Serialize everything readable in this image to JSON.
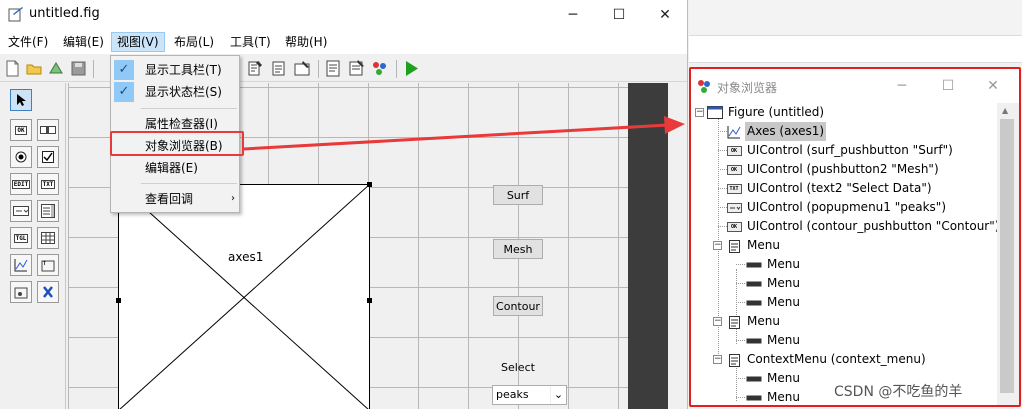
{
  "guide_window": {
    "title": "untitled.fig",
    "controls": {
      "minimize": "─",
      "maximize": "☐",
      "close": "✕"
    },
    "menus": [
      {
        "label": "文件(F)"
      },
      {
        "label": "编辑(E)"
      },
      {
        "label": "视图(V)"
      },
      {
        "label": "布局(L)"
      },
      {
        "label": "工具(T)"
      },
      {
        "label": "帮助(H)"
      }
    ],
    "active_menu": "视图(V)",
    "view_menu": {
      "items": [
        {
          "label": "显示工具栏(T)",
          "checked": true
        },
        {
          "label": "显示状态栏(S)",
          "checked": true
        },
        {
          "label": "属性检查器(I)",
          "checked": false
        },
        {
          "label": "对象浏览器(B)",
          "checked": false,
          "highlighted": true
        },
        {
          "label": "编辑器(E)",
          "checked": false
        },
        {
          "label": "查看回调",
          "checked": false,
          "submenu": true
        }
      ],
      "check_icon": "✓",
      "submenu_icon": "›"
    },
    "palette": {
      "tools": [
        {
          "name": "select-tool",
          "label": ""
        },
        {
          "name": "pushbutton-tool",
          "label": "OK"
        },
        {
          "name": "slider-tool",
          "label": ""
        },
        {
          "name": "radiobutton-tool",
          "label": ""
        },
        {
          "name": "checkbox-tool",
          "label": ""
        },
        {
          "name": "edit-text-tool",
          "label": "EDIT"
        },
        {
          "name": "static-text-tool",
          "label": "TXT"
        },
        {
          "name": "popup-menu-tool",
          "label": ""
        },
        {
          "name": "listbox-tool",
          "label": ""
        },
        {
          "name": "toggle-button-tool",
          "label": "TGL"
        },
        {
          "name": "table-tool",
          "label": ""
        },
        {
          "name": "axes-tool",
          "label": ""
        },
        {
          "name": "panel-tool",
          "label": ""
        },
        {
          "name": "button-group-tool",
          "label": ""
        },
        {
          "name": "activex-tool",
          "label": ""
        }
      ]
    },
    "canvas": {
      "axes_label": "axes1",
      "buttons": [
        {
          "name": "surf-button",
          "label": "Surf"
        },
        {
          "name": "mesh-button",
          "label": "Mesh"
        },
        {
          "name": "contour-button",
          "label": "Contour"
        }
      ],
      "select_label": "Select",
      "popup_value": "peaks",
      "popup_arrow": "⌄"
    }
  },
  "object_browser": {
    "title": "对象浏览器",
    "controls": {
      "minimize": "─",
      "maximize": "☐",
      "close": "✕"
    },
    "tree": [
      {
        "label": "Figure (untitled)",
        "level": 0,
        "icon": "figure-icon",
        "expander": "⊟"
      },
      {
        "label": "Axes (axes1)",
        "level": 1,
        "icon": "axes-icon",
        "selected": true
      },
      {
        "label": "UIControl (surf_pushbutton \"Surf\")",
        "level": 1,
        "icon": "pushbutton-icon",
        "chip": "OK"
      },
      {
        "label": "UIControl (pushbutton2 \"Mesh\")",
        "level": 1,
        "icon": "pushbutton-icon",
        "chip": "OK"
      },
      {
        "label": "UIControl (text2 \"Select Data\")",
        "level": 1,
        "icon": "text-icon",
        "chip": "TXT"
      },
      {
        "label": "UIControl (popupmenu1 \"peaks\")",
        "level": 1,
        "icon": "popupmenu-icon",
        "chip": "▭"
      },
      {
        "label": "UIControl (contour_pushbutton \"Contour\")",
        "level": 1,
        "icon": "pushbutton-icon",
        "chip": "OK"
      },
      {
        "label": "Menu",
        "level": 1,
        "icon": "menu-icon",
        "expander": "⊟"
      },
      {
        "label": "Menu",
        "level": 2,
        "icon": "menu-item-icon"
      },
      {
        "label": "Menu",
        "level": 2,
        "icon": "menu-item-icon"
      },
      {
        "label": "Menu",
        "level": 2,
        "icon": "menu-item-icon"
      },
      {
        "label": "Menu",
        "level": 1,
        "icon": "menu-icon",
        "expander": "⊟"
      },
      {
        "label": "Menu",
        "level": 2,
        "icon": "menu-item-icon"
      },
      {
        "label": "ContextMenu (context_menu)",
        "level": 1,
        "icon": "context-menu-icon",
        "expander": "⊟"
      },
      {
        "label": "Menu",
        "level": 2,
        "icon": "menu-item-icon"
      },
      {
        "label": "Menu",
        "level": 2,
        "icon": "menu-item-icon"
      }
    ]
  },
  "watermark": "CSDN @不吃鱼的羊",
  "colors": {
    "highlight_red": "#e02020",
    "menu_active": "#cce4f7",
    "check_bg": "#90c8f6",
    "selection_gray": "#c8c8c8"
  }
}
